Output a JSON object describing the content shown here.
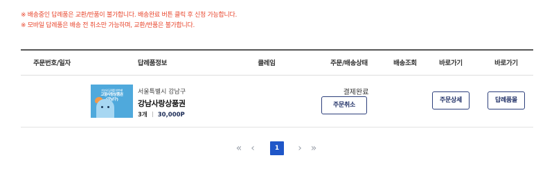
{
  "notices": [
    "※ 배송중인 답례품은 교환/반품이 불가합니다. 배송완료 버튼 클릭 후 신청 가능합니다.",
    "※ 모바일 답례품은 배송 전 취소만 가능하며, 교환/반품은 불가합니다."
  ],
  "table": {
    "headers": [
      "주문번호/일자",
      "답례품정보",
      "클레임",
      "주문/배송상태",
      "배송조회",
      "바로가기",
      "바로가기"
    ]
  },
  "order": {
    "thumbnail_text": [
      "기부와 답례를 한번에!",
      "고향사랑상품권",
      "(강남구)"
    ],
    "region": "서울특별시 강남구",
    "product_name": "강남사랑상품권",
    "quantity": "3개",
    "price": "30,000P",
    "status": "결제완료",
    "cancel_label": "주문취소",
    "detail_label": "주문상세",
    "gift_label": "답례품몰"
  },
  "pagination": {
    "first_icon": "double-chevron-left-icon",
    "prev_icon": "chevron-left-icon",
    "current_page": "1",
    "next_icon": "chevron-right-icon",
    "last_icon": "double-chevron-right-icon"
  },
  "colors": {
    "notice": "#e8452c",
    "accent": "#1f56c8",
    "button_border": "#2a3d7a"
  }
}
